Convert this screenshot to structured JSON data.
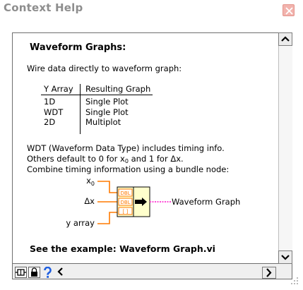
{
  "window": {
    "title": "Context Help"
  },
  "help": {
    "heading": "Waveform Graphs:",
    "intro": "Wire data directly to waveform graph:",
    "table": {
      "headers": [
        "Y Array",
        "Resulting Graph"
      ],
      "rows": [
        [
          "1D",
          "Single Plot"
        ],
        [
          "WDT",
          "Single Plot"
        ],
        [
          "2D",
          "Multiplot"
        ]
      ]
    },
    "paragraph1": "WDT (Waveform Data Type) includes timing info.",
    "paragraph2_pre": "Others default to 0 for x",
    "paragraph2_sub": "0",
    "paragraph2_post": " and 1 for Δx.",
    "paragraph3": "Combine timing information using a bundle node:",
    "diagram": {
      "input_x0": "x",
      "input_x0_sub": "0",
      "input_dx": "Δx",
      "input_array": "y array",
      "terminal_labels": [
        "DBL",
        "DBL",
        "[ ]"
      ],
      "output": "Waveform Graph"
    },
    "footer": "See the example: Waveform Graph.vi"
  },
  "icons": {
    "close": "close-icon",
    "scroll_up": "arrow-up-icon",
    "scroll_down": "arrow-down-icon",
    "scroll_left": "arrow-left-icon",
    "scroll_right": "arrow-right-icon",
    "show_optional": "show-optional-terminals-icon",
    "lock": "lock-icon",
    "detailed_help": "question-mark-icon"
  },
  "colors": {
    "title_text": "#8e8e8e",
    "close_button": "#f2b3ad",
    "wire_orange": "#ff7a00",
    "wire_pink": "#ff4fd8",
    "help_blue": "#1f5fe0"
  }
}
